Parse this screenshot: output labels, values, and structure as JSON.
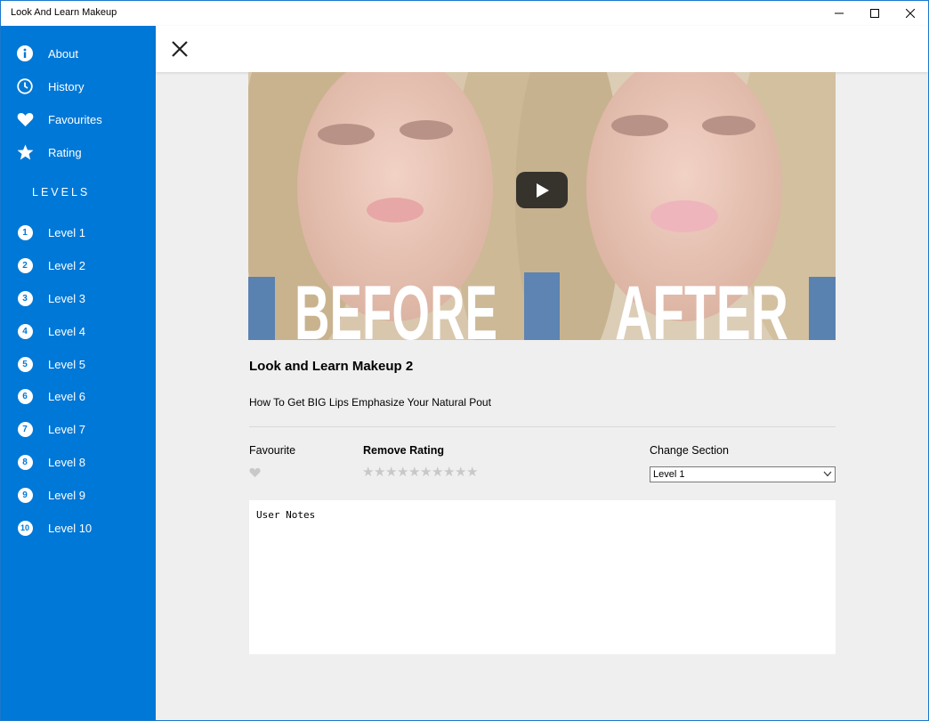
{
  "window": {
    "title": "Look And Learn Makeup"
  },
  "sidebar": {
    "items": [
      {
        "label": "About",
        "icon": "info-icon"
      },
      {
        "label": "History",
        "icon": "clock-icon"
      },
      {
        "label": "Favourites",
        "icon": "heart-icon"
      },
      {
        "label": "Rating",
        "icon": "star-icon"
      }
    ],
    "levels_heading": "LEVELS",
    "levels": [
      {
        "number": "1",
        "label": "Level 1"
      },
      {
        "number": "2",
        "label": "Level 2"
      },
      {
        "number": "3",
        "label": "Level 3"
      },
      {
        "number": "4",
        "label": "Level 4"
      },
      {
        "number": "5",
        "label": "Level 5"
      },
      {
        "number": "6",
        "label": "Level 6"
      },
      {
        "number": "7",
        "label": "Level 7"
      },
      {
        "number": "8",
        "label": "Level 8"
      },
      {
        "number": "9",
        "label": "Level 9"
      },
      {
        "number": "10",
        "label": "Level 10"
      }
    ]
  },
  "video": {
    "thumbnail_text_left": "BEFORE",
    "thumbnail_text_right": "AFTER"
  },
  "detail": {
    "title": "Look and Learn Makeup 2",
    "subtitle": "How To Get BIG Lips Emphasize Your Natural Pout",
    "favourite_label": "Favourite",
    "rating_label": "Remove Rating",
    "rating_value": 0,
    "rating_max": 10,
    "section_label": "Change Section",
    "section_selected": "Level 1",
    "notes_placeholder": "User Notes"
  },
  "colors": {
    "sidebar": "#0078d7",
    "content_bg": "#efefef",
    "star_empty": "#c8c8c8"
  }
}
